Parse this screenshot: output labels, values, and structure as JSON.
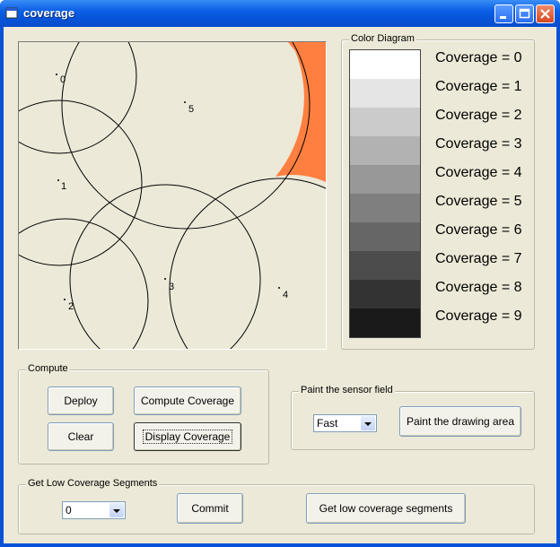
{
  "window": {
    "title": "coverage"
  },
  "canvas": {
    "sensors": [
      {
        "label": "0"
      },
      {
        "label": "1"
      },
      {
        "label": "2"
      },
      {
        "label": "3"
      },
      {
        "label": "4"
      },
      {
        "label": "5"
      }
    ],
    "uncovered_color": "#ff7f40"
  },
  "color_diagram": {
    "title": "Color Diagram",
    "levels": [
      {
        "label": "Coverage = 0",
        "color": "#ffffff"
      },
      {
        "label": "Coverage = 1",
        "color": "#e5e5e5"
      },
      {
        "label": "Coverage = 2",
        "color": "#cbcbcb"
      },
      {
        "label": "Coverage = 3",
        "color": "#b2b2b2"
      },
      {
        "label": "Coverage = 4",
        "color": "#989898"
      },
      {
        "label": "Coverage = 5",
        "color": "#7f7f7f"
      },
      {
        "label": "Coverage = 6",
        "color": "#666666"
      },
      {
        "label": "Coverage = 7",
        "color": "#4c4c4c"
      },
      {
        "label": "Coverage = 8",
        "color": "#333333"
      },
      {
        "label": "Coverage = 9",
        "color": "#1a1a1a"
      }
    ]
  },
  "compute": {
    "title": "Compute",
    "deploy": "Deploy",
    "compute_coverage": "Compute Coverage",
    "clear": "Clear",
    "display_coverage": "Display Coverage"
  },
  "paint": {
    "title": "Paint the sensor field",
    "speed_value": "Fast",
    "paint_button": "Paint the drawing area"
  },
  "low_coverage": {
    "title": "Get Low Coverage Segments",
    "level_value": "0",
    "commit": "Commit",
    "get_segments": "Get low coverage segments"
  }
}
